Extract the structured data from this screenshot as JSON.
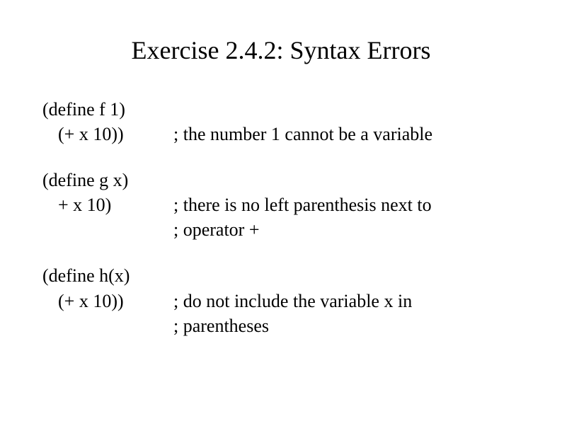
{
  "title": "Exercise 2.4.2: Syntax Errors",
  "examples": [
    {
      "code_line1": "(define f 1)",
      "code_line2": "(+ x 10))",
      "comment_line1": "; the number 1 cannot be a variable",
      "comment_line2": ""
    },
    {
      "code_line1": "(define g x)",
      "code_line2": "+ x 10)",
      "comment_line1": "; there is no left parenthesis next to",
      "comment_line2": "; operator +"
    },
    {
      "code_line1": "(define h(x)",
      "code_line2": "(+ x 10))",
      "comment_line1": "; do not include the variable x in",
      "comment_line2": "; parentheses"
    }
  ]
}
